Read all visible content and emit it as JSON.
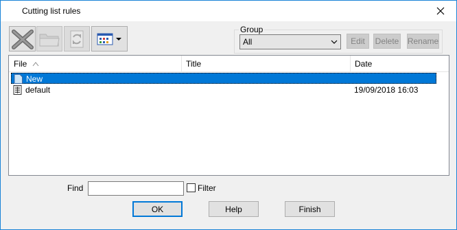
{
  "window": {
    "title": "Cutting list rules",
    "close_icon": "close-icon"
  },
  "toolbar": {
    "buttons": [
      {
        "icon": "delete-x-icon",
        "enabled": true
      },
      {
        "icon": "folder-icon",
        "enabled": false
      },
      {
        "icon": "refresh-icon",
        "enabled": false
      },
      {
        "icon": "view-mode-icon",
        "enabled": true
      }
    ]
  },
  "group": {
    "label": "Group",
    "selected": "All",
    "edit_label": "Edit",
    "delete_label": "Delete",
    "rename_label": "Rename"
  },
  "list": {
    "columns": [
      "File",
      "Title",
      "Date"
    ],
    "rows": [
      {
        "name": "New",
        "title": "",
        "date": "",
        "icon": "blank-document-icon",
        "selected": true
      },
      {
        "name": "default",
        "title": "",
        "date": "19/09/2018  16:03",
        "icon": "spreadsheet-document-icon",
        "selected": false
      }
    ]
  },
  "find": {
    "label": "Find",
    "value": "",
    "filter_label": "Filter",
    "filter_checked": false
  },
  "buttons": {
    "ok": "OK",
    "help": "Help",
    "finish": "Finish"
  },
  "colors": {
    "selection": "#0078d7",
    "window_border": "#1883d7",
    "dialog_bg": "#f0f0f0"
  }
}
